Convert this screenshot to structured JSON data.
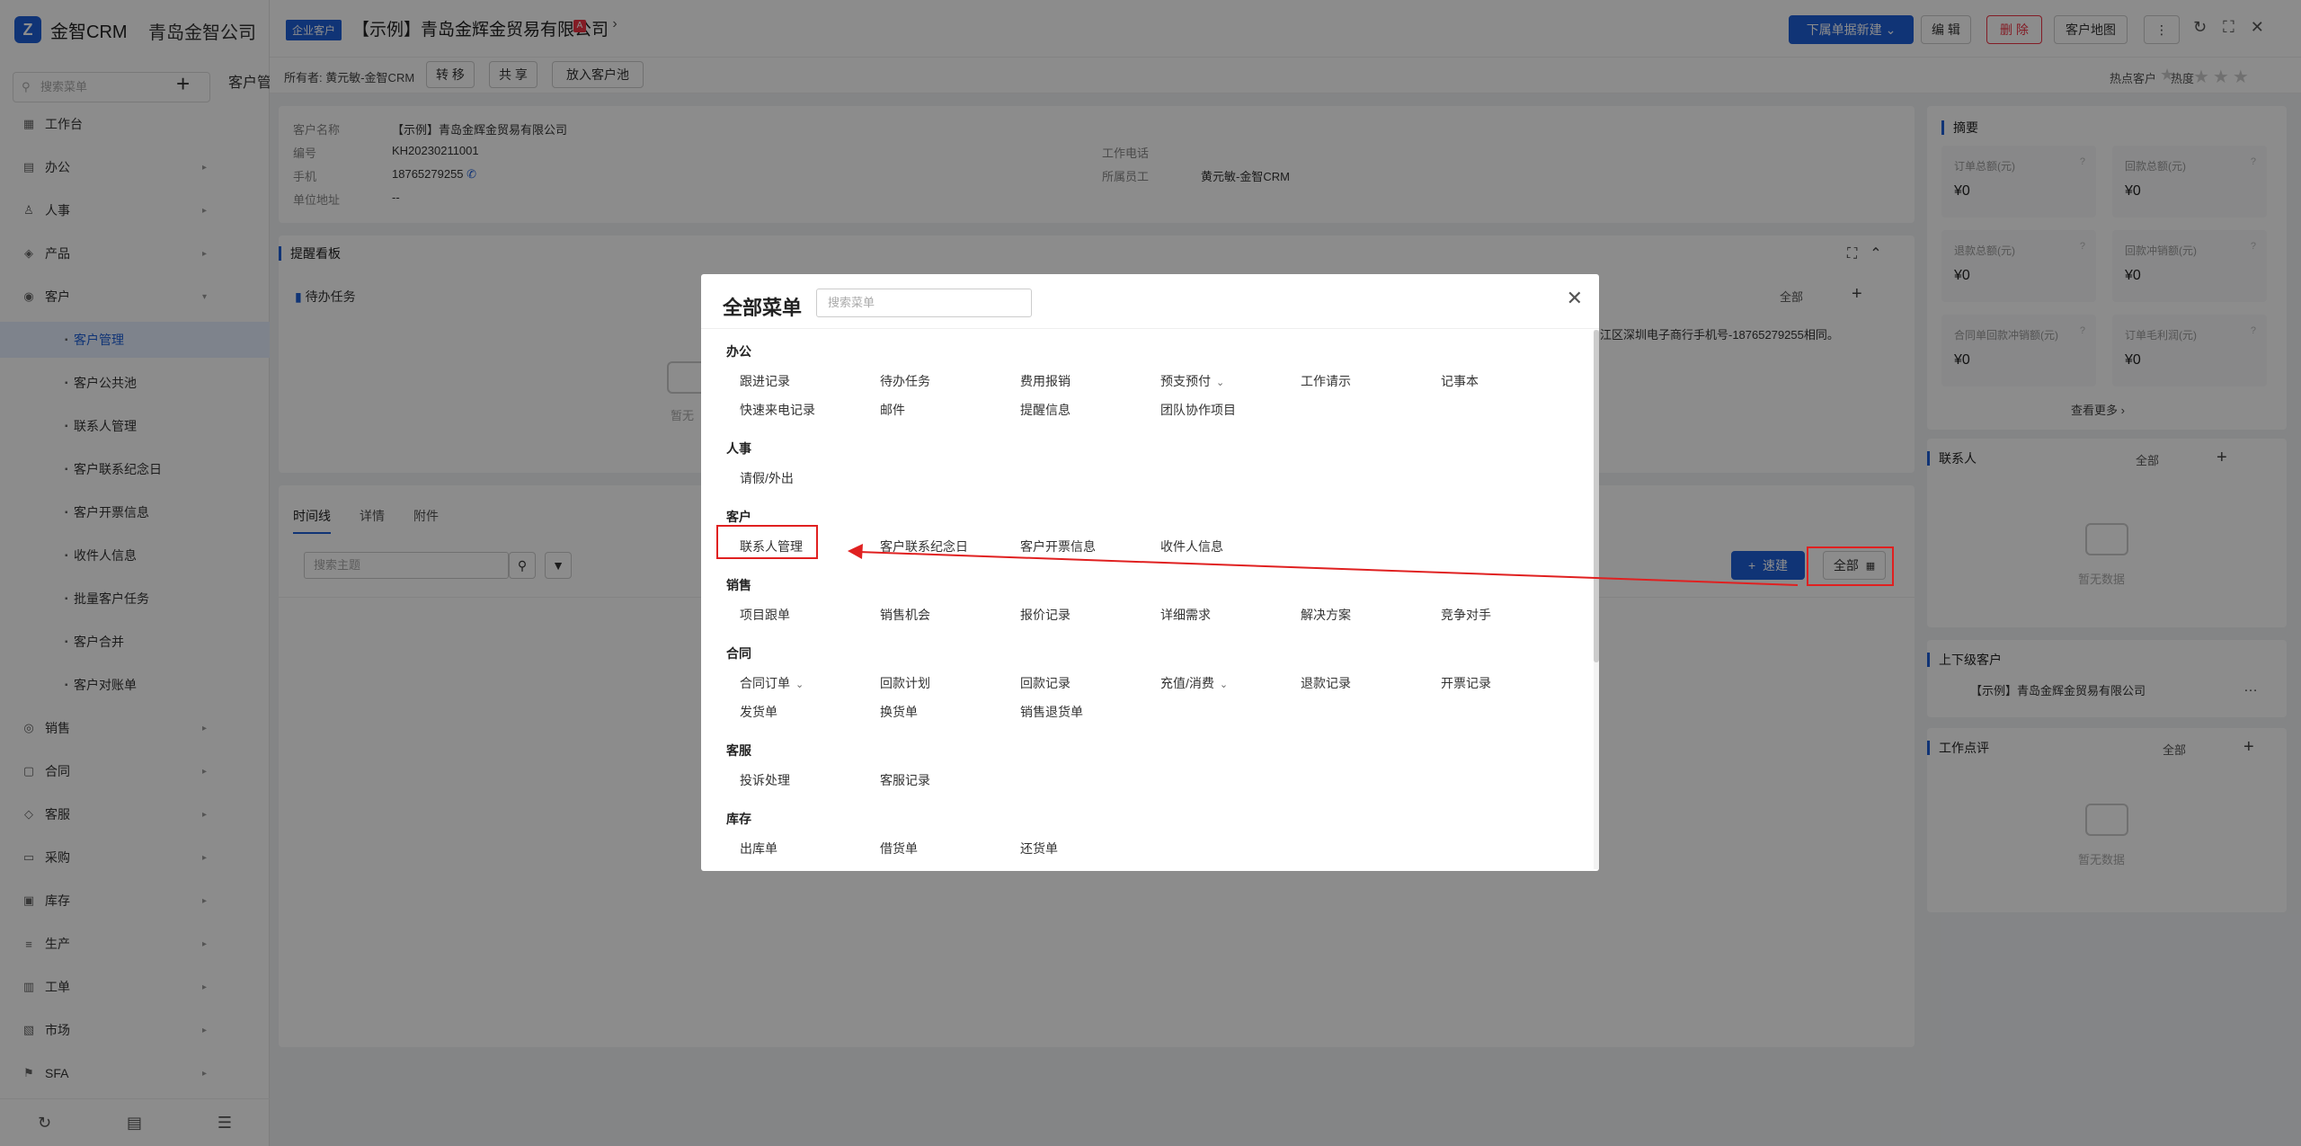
{
  "sidebar": {
    "logo": "金智CRM",
    "logo_mark": "Z",
    "company": "青岛金智公司",
    "search_placeholder": "搜索菜单",
    "items": [
      {
        "label": "工作台",
        "icon": "dashboard-icon"
      },
      {
        "label": "办公",
        "icon": "office-icon"
      },
      {
        "label": "人事",
        "icon": "person-icon"
      },
      {
        "label": "产品",
        "icon": "product-icon"
      },
      {
        "label": "客户",
        "icon": "customer-icon"
      },
      {
        "label": "客户管理",
        "sub": true,
        "active": true
      },
      {
        "label": "客户公共池",
        "sub": true
      },
      {
        "label": "联系人管理",
        "sub": true
      },
      {
        "label": "客户联系纪念日",
        "sub": true
      },
      {
        "label": "客户开票信息",
        "sub": true
      },
      {
        "label": "收件人信息",
        "sub": true
      },
      {
        "label": "批量客户任务",
        "sub": true
      },
      {
        "label": "客户合并",
        "sub": true
      },
      {
        "label": "客户对账单",
        "sub": true
      },
      {
        "label": "销售",
        "icon": "sales-icon"
      },
      {
        "label": "合同",
        "icon": "contract-icon"
      },
      {
        "label": "客服",
        "icon": "service-icon"
      },
      {
        "label": "采购",
        "icon": "purchase-icon"
      },
      {
        "label": "库存",
        "icon": "inventory-icon"
      },
      {
        "label": "生产",
        "icon": "production-icon"
      },
      {
        "label": "工单",
        "icon": "workorder-icon"
      },
      {
        "label": "市场",
        "icon": "market-icon"
      },
      {
        "label": "SFA",
        "icon": "sfa-icon"
      }
    ],
    "footer_icons": [
      "history-icon",
      "chart-icon",
      "settings-list-icon"
    ]
  },
  "page": {
    "tab_peek": "客户管",
    "badge": "企业客户",
    "title": "【示例】青岛金辉金贸易有限公司",
    "tag": "A",
    "actions": {
      "new_sub": "下属单据新建",
      "edit": "编 辑",
      "delete": "删 除",
      "map": "客户地图",
      "more": "⋮"
    },
    "owner": "所有者: 黄元敏-金智CRM",
    "sub_actions": [
      "转 移",
      "共 享",
      "放入客户池"
    ],
    "hot_label": "热点客户",
    "heat_label": "热度",
    "info": {
      "name_label": "客户名称",
      "name": "【示例】青岛金辉金贸易有限公司",
      "code_label": "编号",
      "code": "KH20230211001",
      "phone_label": "手机",
      "phone": "18765279255",
      "addr_label": "单位地址",
      "addr": "--",
      "work_phone_label": "工作电话",
      "staff_label": "所属员工",
      "staff": "黄元敏-金智CRM"
    },
    "reminder": {
      "title": "提醒看板",
      "todo": "待办任务",
      "filter": "全部",
      "snippet": "江区深圳电子商行手机号-18765279255相同。",
      "empty": "暂无"
    },
    "timeline": {
      "tabs": [
        "时间线",
        "详情",
        "附件"
      ],
      "search_placeholder": "搜索主题",
      "quick_new": "速建",
      "filter": "全部"
    },
    "summary": {
      "title": "摘要",
      "stats": [
        {
          "label": "订单总额(元)",
          "value": "¥0"
        },
        {
          "label": "回款总额(元)",
          "value": "¥0"
        },
        {
          "label": "退款总额(元)",
          "value": "¥0"
        },
        {
          "label": "回款冲销额(元)",
          "value": "¥0"
        },
        {
          "label": "合同单回款冲销额(元)",
          "value": "¥0"
        },
        {
          "label": "订单毛利润(元)",
          "value": "¥0"
        }
      ],
      "more": "查看更多"
    },
    "contacts": {
      "title": "联系人",
      "filter": "全部",
      "empty": "暂无数据"
    },
    "parent": {
      "title": "上下级客户",
      "item": "【示例】青岛金辉金贸易有限公司"
    },
    "reviews": {
      "title": "工作点评",
      "filter": "全部",
      "empty": "暂无数据"
    }
  },
  "modal": {
    "title": "全部菜单",
    "search_placeholder": "搜索菜单",
    "groups": [
      {
        "name": "办公",
        "items": [
          "跟进记录",
          "待办任务",
          "费用报销",
          "预支预付",
          "工作请示",
          "记事本",
          "快速来电记录",
          "邮件",
          "提醒信息",
          "团队协作项目"
        ]
      },
      {
        "name": "人事",
        "items": [
          "请假/外出"
        ]
      },
      {
        "name": "客户",
        "items": [
          "联系人管理",
          "客户联系纪念日",
          "客户开票信息",
          "收件人信息"
        ]
      },
      {
        "name": "销售",
        "items": [
          "项目跟单",
          "销售机会",
          "报价记录",
          "详细需求",
          "解决方案",
          "竞争对手"
        ]
      },
      {
        "name": "合同",
        "items": [
          "合同订单",
          "回款计划",
          "回款记录",
          "充值/消费",
          "退款记录",
          "开票记录",
          "发货单",
          "换货单",
          "销售退货单"
        ]
      },
      {
        "name": "客服",
        "items": [
          "投诉处理",
          "客服记录"
        ]
      },
      {
        "name": "库存",
        "items": [
          "出库单",
          "借货单",
          "还货单"
        ]
      }
    ]
  }
}
